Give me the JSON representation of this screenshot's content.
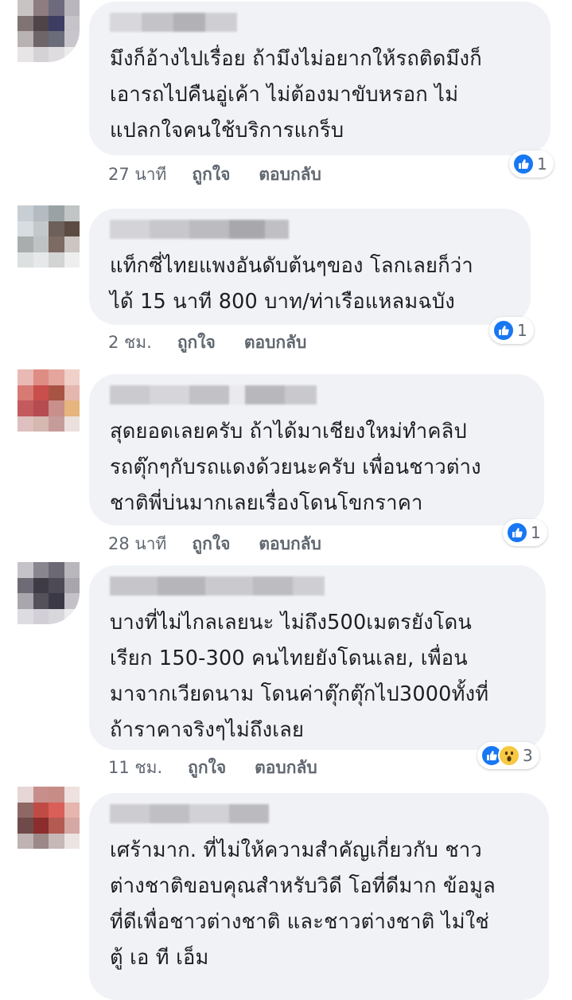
{
  "actions": {
    "like": "ถูกใจ",
    "reply": "ตอบกลับ"
  },
  "comments": [
    {
      "lines": [
        "มึงก็อ้างไปเรื่อย ถ้ามึงไม่อยากให้รถติดมึงก็",
        "เอารถไปคืนอู่เค้า ไม่ต้องมาขับหรอก ไม่",
        "แปลกใจคนใช้บริการแกร็บ"
      ],
      "time": "27 นาที",
      "reactions": {
        "types": [
          "like"
        ],
        "count": "1"
      }
    },
    {
      "lines": [
        "แท็กซี่ไทยแพงอันดับต้นๆของ โลกเลยก็ว่า",
        "ได้ 15 นาที 800 บาท/ท่าเรือแหลมฉบัง"
      ],
      "time": "2 ชม.",
      "reactions": {
        "types": [
          "like"
        ],
        "count": "1"
      }
    },
    {
      "lines": [
        "สุดยอดเลยครับ ถ้าได้มาเชียงใหม่ทำคลิป",
        "รถตุ๊กๆกับรถแดงด้วยนะครับ เพื่อนชาวต่าง",
        "ชาติพี่บ่นมากเลยเรื่องโดนโขกราคา"
      ],
      "time": "28 นาที",
      "reactions": {
        "types": [
          "like"
        ],
        "count": "1"
      }
    },
    {
      "lines": [
        "บางที่ไม่ไกลเลยนะ ไม่ถึง500เมตรยังโดน",
        "เรียก 150-300 คนไทยยังโดนเลย, เพื่อน",
        "มาจากเวียดนาม โดนค่าตุ๊กตุ๊กไป3000ทั้งที่",
        "ถ้าราคาจริงๆไม่ถึงเลย"
      ],
      "time": "11 ชม.",
      "reactions": {
        "types": [
          "like",
          "wow"
        ],
        "count": "3"
      }
    },
    {
      "lines": [
        "เศร้ามาก. ที่ไม่ให้ความสำคัญเกี่ยวกับ ชาว",
        "ต่างชาติขอบคุณสำหรับวิดี โอที่ดีมาก ข้อมูล",
        "ที่ดีเพื่อชาวต่างชาติ และชาวต่างชาติ ไม่ใช่",
        "ตู้ เอ ที เอ็ม"
      ]
    }
  ]
}
